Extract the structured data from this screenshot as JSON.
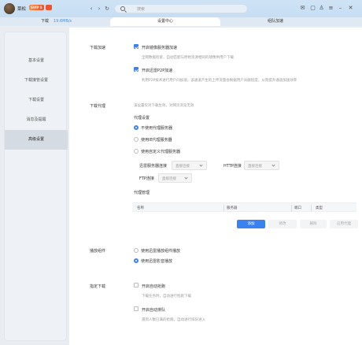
{
  "titlebar": {
    "username": "菜松",
    "vip_label": "SVIP 5",
    "search_placeholder": "搜索",
    "back": "‹",
    "forward": "›",
    "refresh": "↻",
    "icons": [
      "mail-icon",
      "box-icon",
      "shirt-icon",
      "menu-icon",
      "minimize-icon",
      "close-icon"
    ]
  },
  "tabs": {
    "download": "下载",
    "speed": "19.6MB/s",
    "settings": "设置中心",
    "accel": "组队加速"
  },
  "sidebar": {
    "items": [
      "基本设置",
      "下载接管设置",
      "下载设置",
      "消息及提醒",
      "高级设置"
    ],
    "active_index": 4
  },
  "sections": {
    "accel": {
      "label": "下载加速",
      "mirror_label": "开启镜像服务器加速",
      "mirror_hint": "全网数据检索，自动匹配与原始资源相同的镜像供用户下载",
      "p2p_label": "开启迅雷P2P加速",
      "p2p_hint": "利用P2P技术进行用户间加速，该通道产生的上传流量会根据用户贡献程度，从而提升通道加速效率"
    },
    "proxy": {
      "label": "下载代理",
      "hint": "该设置仅对下载生效，对网页浏览无效",
      "settings_title": "代理设置",
      "options": [
        "不使用代理服务器",
        "使用IE代理服务器",
        "使用自定义代理服务器"
      ],
      "selected": 0,
      "thunder_conn_label": "迅雷服务器连接",
      "thunder_conn_value": "直接连接",
      "http_label": "HTTP连接",
      "http_value": "直接连接",
      "ftp_label": "FTP连接",
      "ftp_value": "直接连接",
      "manage_title": "代理管理",
      "columns": [
        "名称",
        "服务器",
        "端口",
        "类型"
      ],
      "buttons": {
        "add": "添加",
        "edit": "修改",
        "delete": "删除",
        "apply": "应用代理"
      }
    },
    "player": {
      "label": "播放组件",
      "options": [
        "使用迅雷播放组件播放",
        "使用迅雷影音播放"
      ],
      "selected": 1
    },
    "scheduled": {
      "label": "指定下载",
      "auto_label": "开启自动抢跑",
      "auto_hint": "下载任务时，自动进行抢跑下载",
      "queue_label": "开启自动排队",
      "queue_hint": "遇到人数已满的抢跑，自动进行排队进入"
    }
  },
  "colors": {
    "accent": "#3b82f0",
    "speed": "#4a8fe8"
  }
}
